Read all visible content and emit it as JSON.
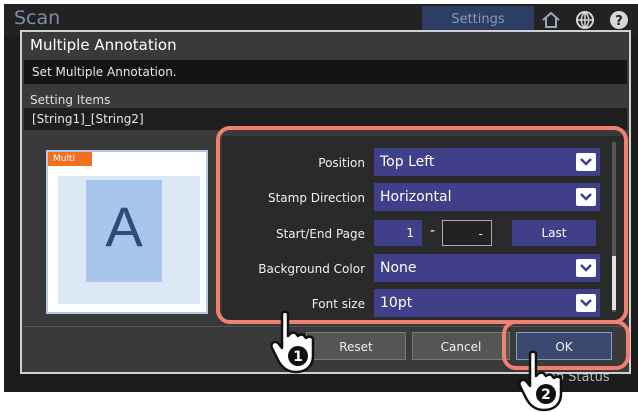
{
  "background": {
    "app_title": "Scan",
    "settings_tab": "Settings",
    "job_status": "Job Status",
    "icons": [
      "home-icon",
      "globe-icon",
      "help-icon"
    ]
  },
  "dialog": {
    "title": "Multiple Annotation",
    "message": "Set Multiple Annotation.",
    "setting_items_label": "Setting Items",
    "setting_items_value": "[String1]_[String2]",
    "preview": {
      "badge": "Multi",
      "letter": "A"
    },
    "fields": {
      "position": {
        "label": "Position",
        "value": "Top Left"
      },
      "stamp_direction": {
        "label": "Stamp Direction",
        "value": "Horizontal"
      },
      "start_end_page": {
        "label": "Start/End Page",
        "start": "1",
        "separator": "-",
        "end": "-",
        "last_button": "Last"
      },
      "background_color": {
        "label": "Background Color",
        "value": "None"
      },
      "font_size": {
        "label": "Font size",
        "value": "10pt"
      }
    },
    "buttons": {
      "reset": "Reset",
      "cancel": "Cancel",
      "ok": "OK"
    }
  },
  "callouts": {
    "step1": "1",
    "step2": "2"
  },
  "colors": {
    "accent_blue": "#3f3f8a",
    "callout_red": "#f08070",
    "badge_orange": "#f07020"
  }
}
